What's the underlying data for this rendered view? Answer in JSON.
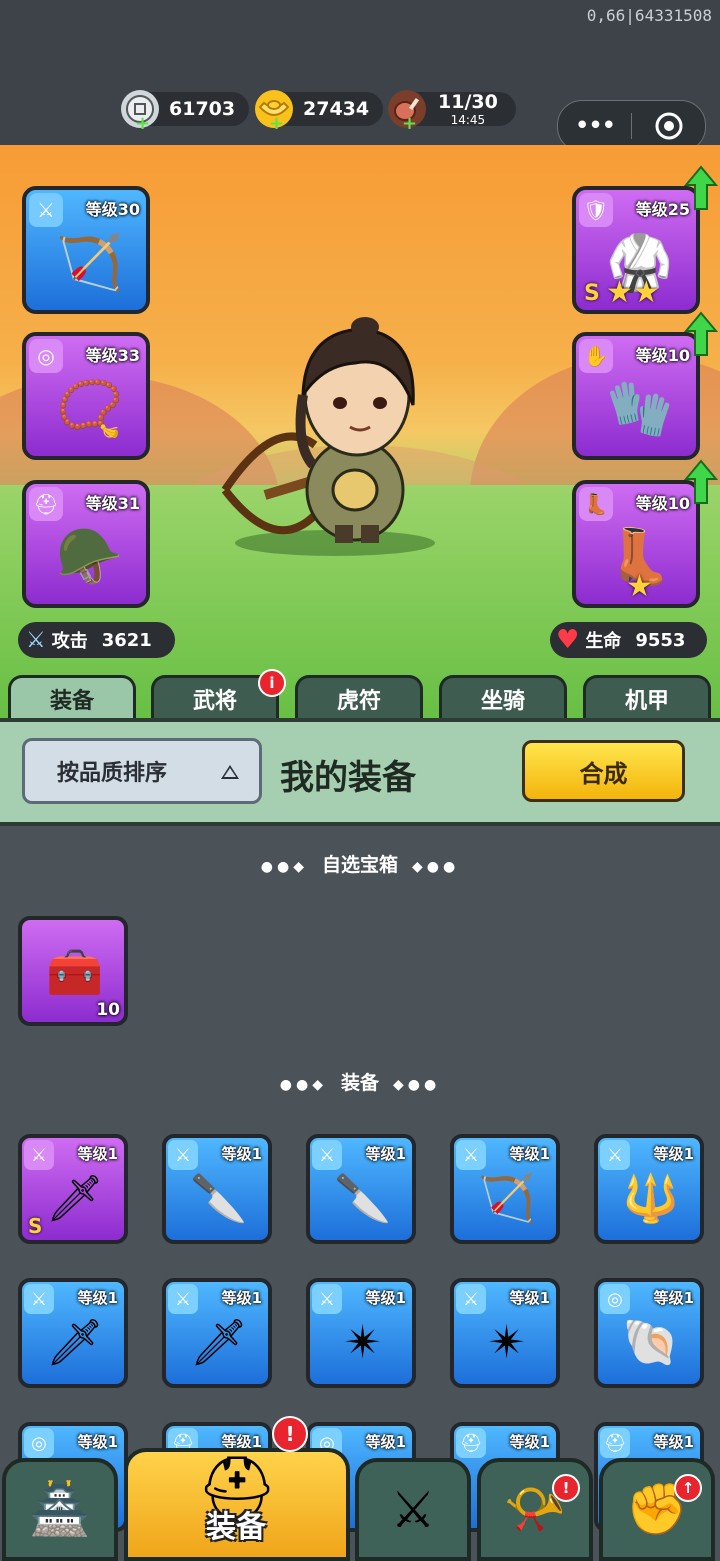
{
  "status": {
    "version": "0,66|64331508"
  },
  "resources": [
    {
      "icon": "silver-coin-icon",
      "value": "61703"
    },
    {
      "icon": "gold-ingot-icon",
      "value": "27434"
    },
    {
      "icon": "meat-stamina-icon",
      "value": "11/30",
      "timer": "14:45"
    }
  ],
  "capsule": {
    "more": "•••",
    "close_icon": "target-icon"
  },
  "equipped_left": [
    {
      "icon": "sword-tag-icon",
      "tag": "⚔",
      "level": "等级30",
      "art": "🏹",
      "color": "blue"
    },
    {
      "icon": "medal-tag-icon",
      "tag": "◎",
      "level": "等级33",
      "art": "📿",
      "color": "purple"
    },
    {
      "icon": "helmet-tag-icon",
      "tag": "⛑",
      "level": "等级31",
      "art": "🪖",
      "color": "purple"
    }
  ],
  "equipped_right": [
    {
      "icon": "armor-tag-icon",
      "tag": "🛡",
      "level": "等级25",
      "art": "🥋",
      "color": "purple",
      "rank": "S",
      "stars": "★★"
    },
    {
      "icon": "bracer-tag-icon",
      "tag": "✋",
      "level": "等级10",
      "art": "🧤",
      "color": "purple"
    },
    {
      "icon": "boots-tag-icon",
      "tag": "👢",
      "level": "等级10",
      "art": "👢",
      "color": "purple",
      "stars": "★"
    }
  ],
  "stats": {
    "attack_label": "攻击",
    "attack_value": "3621",
    "hp_label": "生命",
    "hp_value": "9553"
  },
  "tabs": [
    "装备",
    "武将",
    "虎符",
    "坐骑",
    "机甲"
  ],
  "tab_badge": "i",
  "filter": {
    "sort_label": "按品质排序",
    "title": "我的装备",
    "merge_label": "合成"
  },
  "sections": {
    "chest_title": "自选宝箱",
    "equip_title": "装备"
  },
  "chest": {
    "art": "🧰",
    "count": "10"
  },
  "items_row1": [
    {
      "level": "等级1",
      "art": "🗡",
      "color": "purple",
      "rank": "S"
    },
    {
      "level": "等级1",
      "art": "🔪",
      "color": "blue"
    },
    {
      "level": "等级1",
      "art": "🔪",
      "color": "blue"
    },
    {
      "level": "等级1",
      "art": "🏹",
      "color": "blue"
    },
    {
      "level": "等级1",
      "art": "🔱",
      "color": "blue"
    }
  ],
  "items_row2": [
    {
      "level": "等级1",
      "art": "🗡",
      "color": "blue"
    },
    {
      "level": "等级1",
      "art": "🗡",
      "color": "blue"
    },
    {
      "level": "等级1",
      "art": "✴",
      "color": "blue"
    },
    {
      "level": "等级1",
      "art": "✴",
      "color": "blue"
    },
    {
      "level": "等级1",
      "art": "🐚",
      "color": "blue",
      "tag": "◎"
    }
  ],
  "items_row3": [
    {
      "level": "等级1",
      "color": "blue",
      "tag": "◎"
    },
    {
      "level": "等级1",
      "color": "blue"
    },
    {
      "level": "等级1",
      "color": "blue",
      "tag": "◎"
    },
    {
      "level": "等级1",
      "color": "blue"
    },
    {
      "level": "等级1",
      "color": "blue"
    }
  ],
  "bottom_nav": {
    "active_label": "装备",
    "badge": "!"
  }
}
